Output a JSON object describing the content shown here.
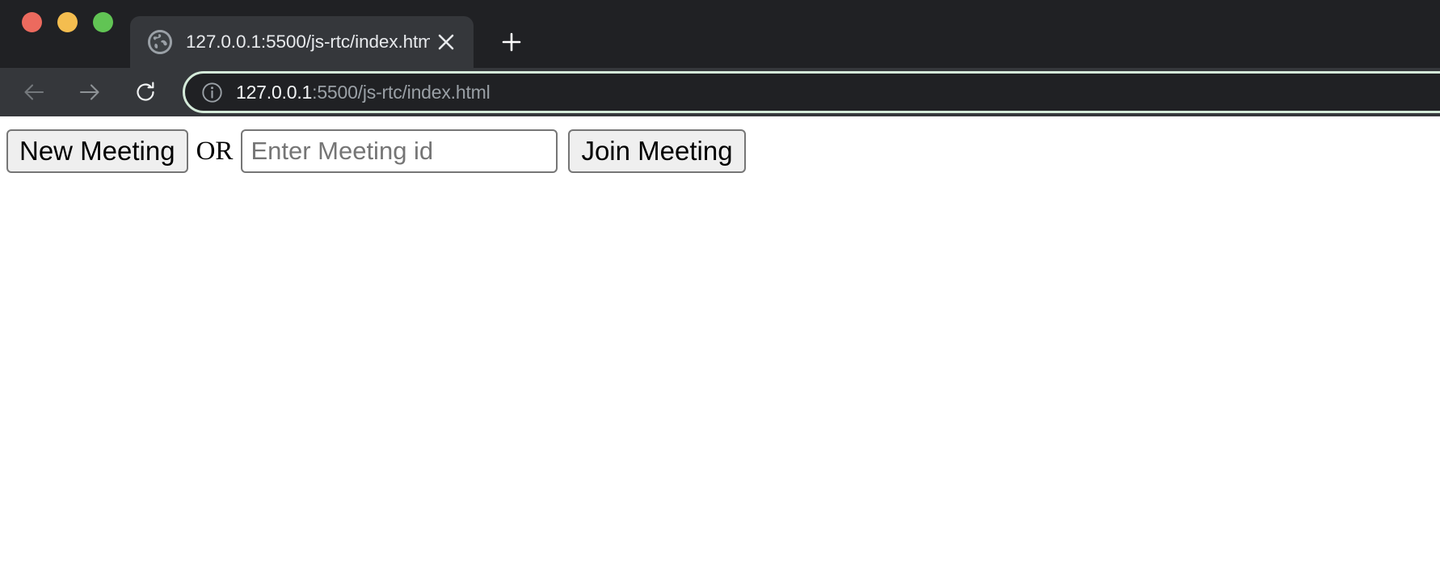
{
  "window": {
    "traffic_lights": [
      {
        "name": "close",
        "color": "#ec6a5e"
      },
      {
        "name": "minimize",
        "color": "#f4bd4f"
      },
      {
        "name": "zoom",
        "color": "#61c454"
      }
    ]
  },
  "tabbar": {
    "tabs": [
      {
        "title": "127.0.0.1:5500/js-rtc/index.htm",
        "favicon": "globe-icon",
        "close_label": "✕",
        "active": true
      }
    ],
    "new_tab_label": "+"
  },
  "toolbar": {
    "back_icon": "arrow-left-icon",
    "forward_icon": "arrow-right-icon",
    "reload_icon": "reload-icon",
    "omnibox": {
      "security_icon": "info-circle-icon",
      "host": "127.0.0.1",
      "path": ":5500/js-rtc/index.html",
      "full_url": "127.0.0.1:5500/js-rtc/index.html",
      "focus_ring_color": "#d4ead9"
    }
  },
  "page": {
    "new_meeting_label": "New Meeting",
    "or_label": "OR",
    "meeting_id_placeholder": "Enter Meeting id",
    "meeting_id_value": "",
    "join_meeting_label": "Join Meeting"
  }
}
